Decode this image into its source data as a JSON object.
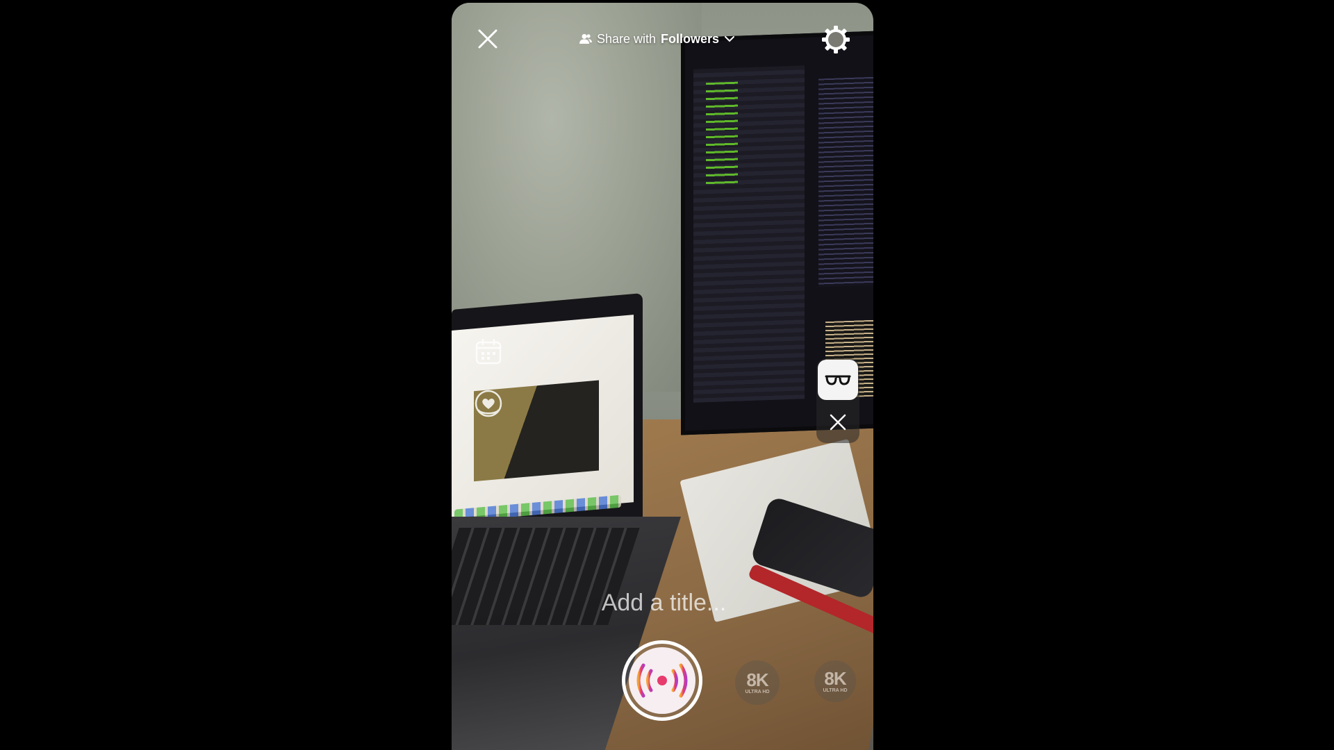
{
  "top_bar": {
    "share_prefix": "Share with",
    "share_audience": "Followers",
    "close_icon": "close-icon",
    "settings_icon": "gear-icon"
  },
  "left_tools": [
    {
      "name": "calendar-icon"
    },
    {
      "name": "heart-bubble-icon"
    }
  ],
  "effects": {
    "active_icon": "glasses-icon",
    "remove_icon": "close-icon"
  },
  "title_input": {
    "placeholder": "Add a title...",
    "value": ""
  },
  "go_live": {
    "icon": "broadcast-icon",
    "gradient": [
      "#f2a33a",
      "#e73a6d",
      "#b23cc6"
    ]
  },
  "quality_options": [
    {
      "label": "8K",
      "sublabel": "ULTRA HD"
    },
    {
      "label": "8K",
      "sublabel": "ULTRA HD"
    }
  ],
  "colors": {
    "overlay_text": "#ffffff",
    "live_red": "#e73a6d"
  }
}
